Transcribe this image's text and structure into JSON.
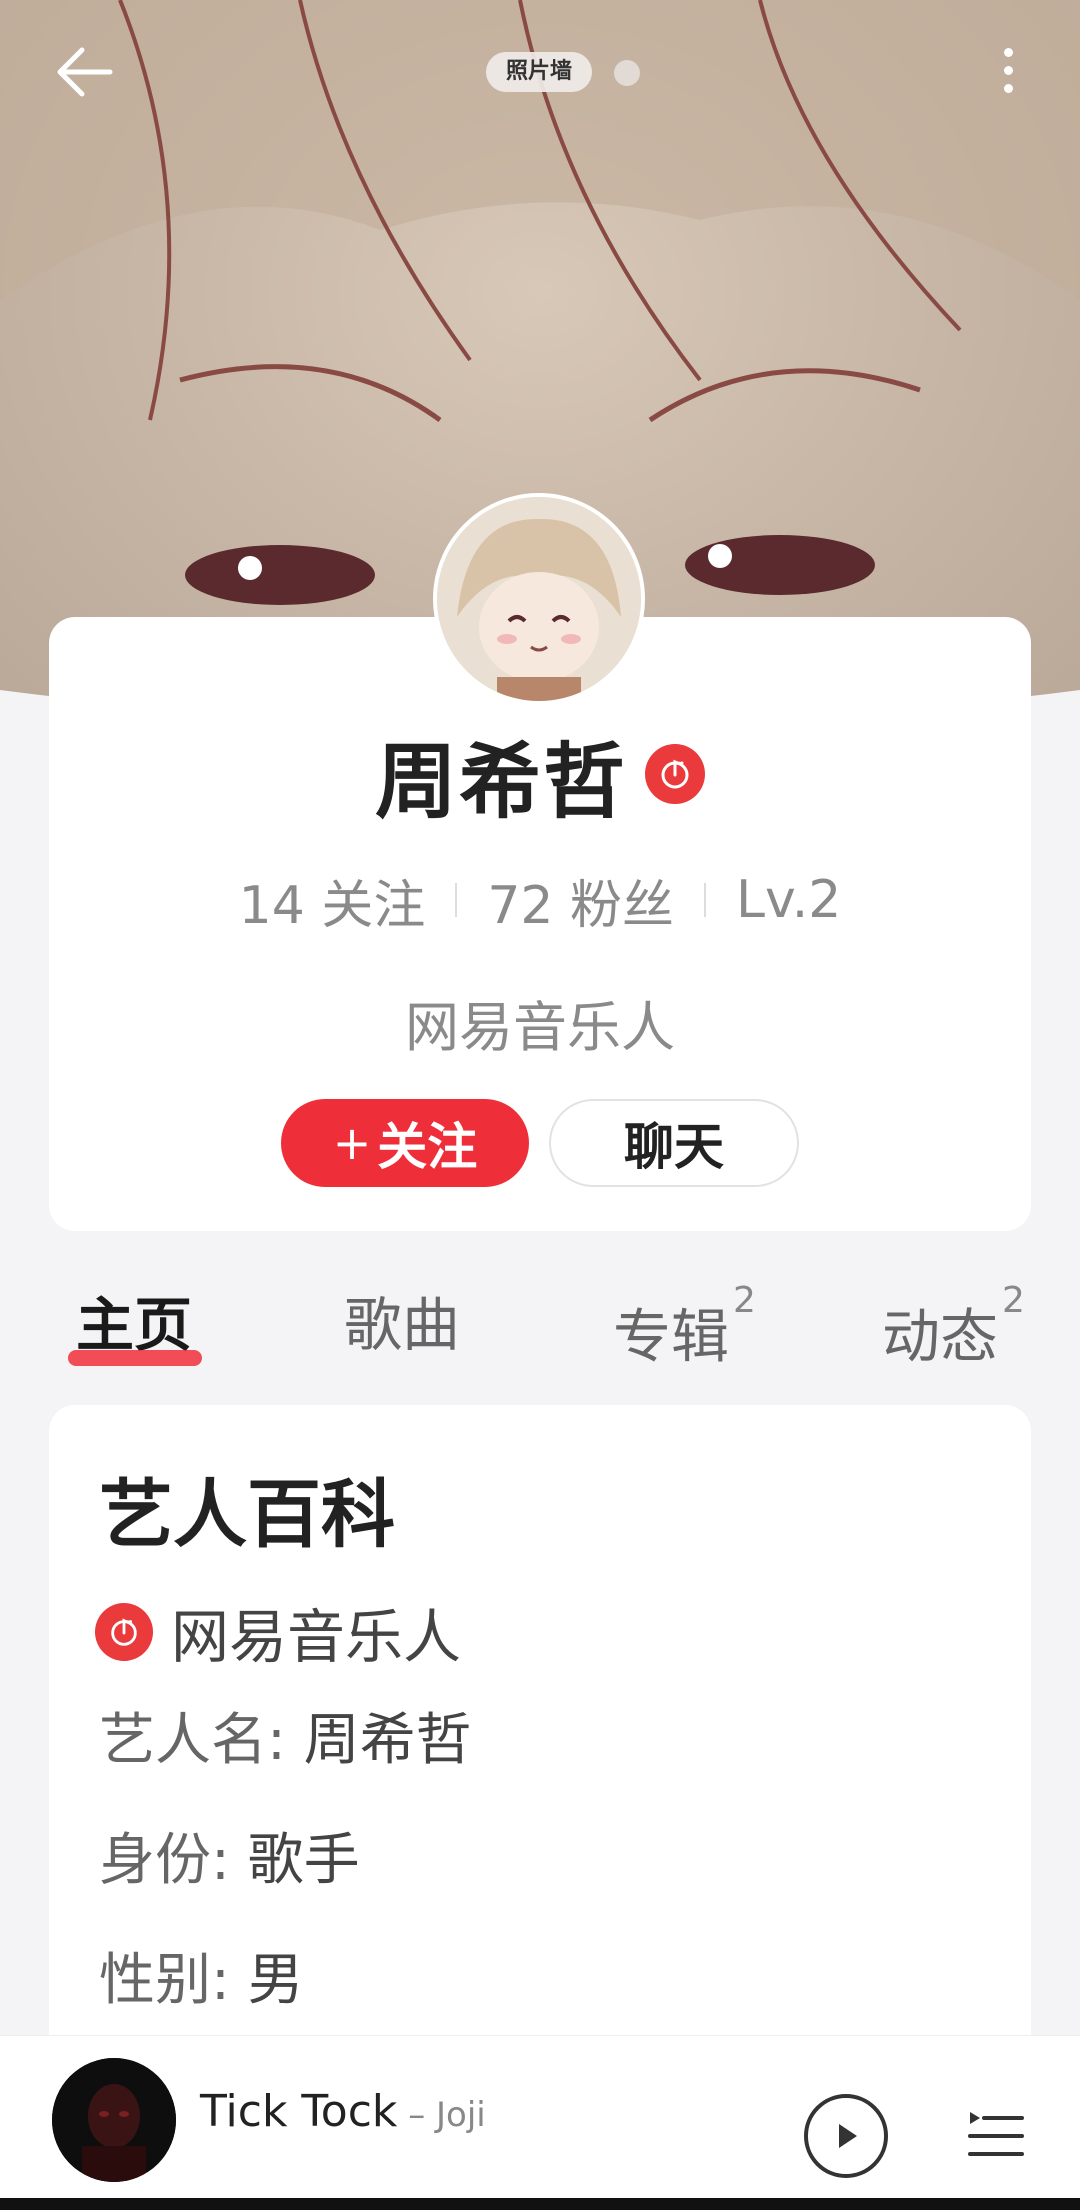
{
  "header": {
    "photo_wall_label": "照片墙"
  },
  "profile": {
    "name": "周希哲",
    "following_count": "14",
    "following_label": "关注",
    "followers_count": "72",
    "followers_label": "粉丝",
    "level": "Lv.2",
    "identity": "网易音乐人",
    "follow_plus": "+",
    "follow_label": "关注",
    "chat_label": "聊天"
  },
  "tabs": [
    {
      "label": "主页",
      "count": ""
    },
    {
      "label": "歌曲",
      "count": ""
    },
    {
      "label": "专辑",
      "count": "2"
    },
    {
      "label": "动态",
      "count": "2"
    }
  ],
  "wiki": {
    "title": "艺人百科",
    "tag": "网易音乐人",
    "fields": [
      {
        "key": "艺人名: ",
        "value": "周希哲"
      },
      {
        "key": "身份: ",
        "value": "歌手"
      },
      {
        "key": "性别: ",
        "value": "男"
      }
    ]
  },
  "player": {
    "track_title": "Tick Tock",
    "artist_separator": " – ",
    "artist": "Joji"
  },
  "colors": {
    "accent": "#ee2f3a",
    "badge": "#ea3a3b"
  },
  "icons": [
    "back-arrow-icon",
    "more-vertical-icon",
    "music-note-badge-icon",
    "play-icon",
    "playlist-icon"
  ]
}
